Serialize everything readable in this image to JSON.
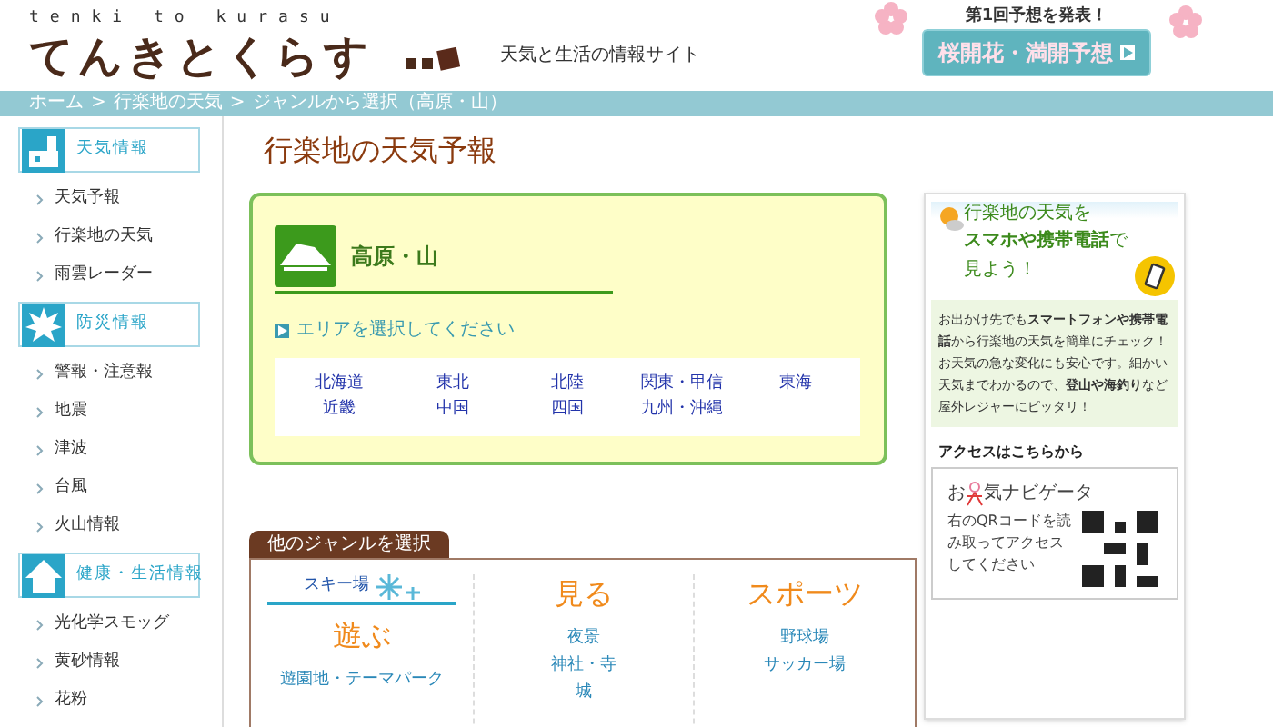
{
  "header": {
    "romaji": "tenki to kurasu",
    "logo": "てんきとくらす",
    "tagline": "天気と生活の情報サイト",
    "promo_note": "第1回予想を発表！",
    "promo_button": "桜開花・満開予想"
  },
  "breadcrumb": [
    "ホーム",
    ">",
    "行楽地の天気",
    ">",
    "ジャンルから選択（高原・山）"
  ],
  "sidebar": [
    {
      "title": "天気情報",
      "kind": "weather",
      "items": [
        "天気予報",
        "行楽地の天気",
        "雨雲レーダー"
      ]
    },
    {
      "title": "防災情報",
      "kind": "disaster",
      "items": [
        "警報・注意報",
        "地震",
        "津波",
        "台風",
        "火山情報"
      ]
    },
    {
      "title": "健康・生活情報",
      "kind": "life",
      "items": [
        "光化学スモッグ",
        "黄砂情報",
        "花粉"
      ]
    }
  ],
  "page_title": "行楽地の天気予報",
  "genre_box": {
    "title": "高原・山",
    "prompt": "エリアを選択してください",
    "areas": [
      "北海道",
      "東北",
      "北陸",
      "関東・甲信",
      "東海",
      "近畿",
      "中国",
      "四国",
      "九州・沖縄"
    ]
  },
  "other_genres": {
    "tab": "他のジャンルを選択",
    "columns": [
      {
        "top_link": "スキー場",
        "heading": "遊ぶ",
        "links": [
          "遊園地・テーマパーク"
        ]
      },
      {
        "heading": "見る",
        "links": [
          "夜景",
          "神社・寺",
          "城"
        ]
      },
      {
        "heading": "スポーツ",
        "links": [
          "野球場",
          "サッカー場"
        ]
      }
    ]
  },
  "mobile_panel": {
    "line1": "行楽地の天気を",
    "line2": "**スマホや携帯電話**で",
    "line3": "見よう！",
    "body": "お出かけ先でも**スマートフォンや携帯電話**から行楽地の天気を簡単にチェック！お天気の急な変化にも安心です。細かい天気までわかるので、**登山や海釣り**など屋外レジャーにピッタリ！",
    "access_title": "アクセスはこちらから",
    "logo_start": "お",
    "logo_end": "気ナビゲータ",
    "qr_text": "右のQRコードを読み取ってアクセスしてください"
  }
}
